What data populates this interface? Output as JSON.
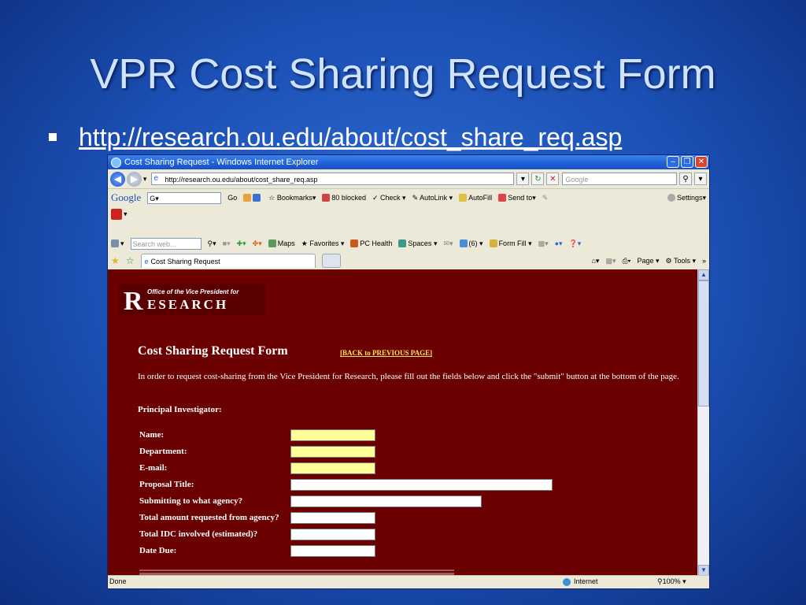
{
  "slide": {
    "title": "VPR Cost Sharing Request Form",
    "bullet_link": "http://research.ou.edu/about/cost_share_req.asp"
  },
  "browser": {
    "window_title": "Cost Sharing Request - Windows Internet Explorer",
    "address": "http://research.ou.edu/about/cost_share_req.asp",
    "search_placeholder": "Google",
    "google_toolbar": {
      "logo": "Google",
      "go": "Go",
      "bookmarks": "Bookmarks",
      "blocked": "80 blocked",
      "check": "Check",
      "autolink": "AutoLink",
      "autofill": "AutoFill",
      "sendto": "Send to",
      "settings": "Settings"
    },
    "msn_toolbar": {
      "search_placeholder": "Search web...",
      "maps": "Maps",
      "favorites": "Favorites",
      "pchealth": "PC Health",
      "spaces": "Spaces",
      "count": "(6)",
      "formfill": "Form Fill"
    },
    "tab_label": "Cost Sharing Request",
    "command_bar": {
      "page": "Page",
      "tools": "Tools",
      "more": "»"
    },
    "status": {
      "done": "Done",
      "zone": "Internet",
      "zoom": "100%"
    }
  },
  "page": {
    "logo": {
      "letter": "R",
      "line1": "Office of the Vice President for",
      "line2": "ESEARCH"
    },
    "form_title": "Cost Sharing Request Form",
    "back_link": "[BACK to PREVIOUS PAGE]",
    "intro": "In order to request cost-sharing from the Vice President for Research, please fill out the fields below and click the \"submit\" button at the bottom of the page.",
    "pi_heading": "Principal Investigator:",
    "fields": [
      {
        "label": "Name:",
        "required": true
      },
      {
        "label": "Department:",
        "required": true
      },
      {
        "label": "E-mail:",
        "required": true
      },
      {
        "label": "Proposal Title:",
        "required": false
      },
      {
        "label": "Submitting to what agency?",
        "required": false
      },
      {
        "label": "Total amount requested from agency?",
        "required": false
      },
      {
        "label": "Total IDC involved (estimated)?",
        "required": false
      },
      {
        "label": "Date Due:",
        "required": false
      }
    ]
  },
  "colors": {
    "slide_bg": "#1b4fb3",
    "page_bg": "#6b0000",
    "required_field": "#ffff99",
    "link_yellow": "#ffe65a"
  }
}
